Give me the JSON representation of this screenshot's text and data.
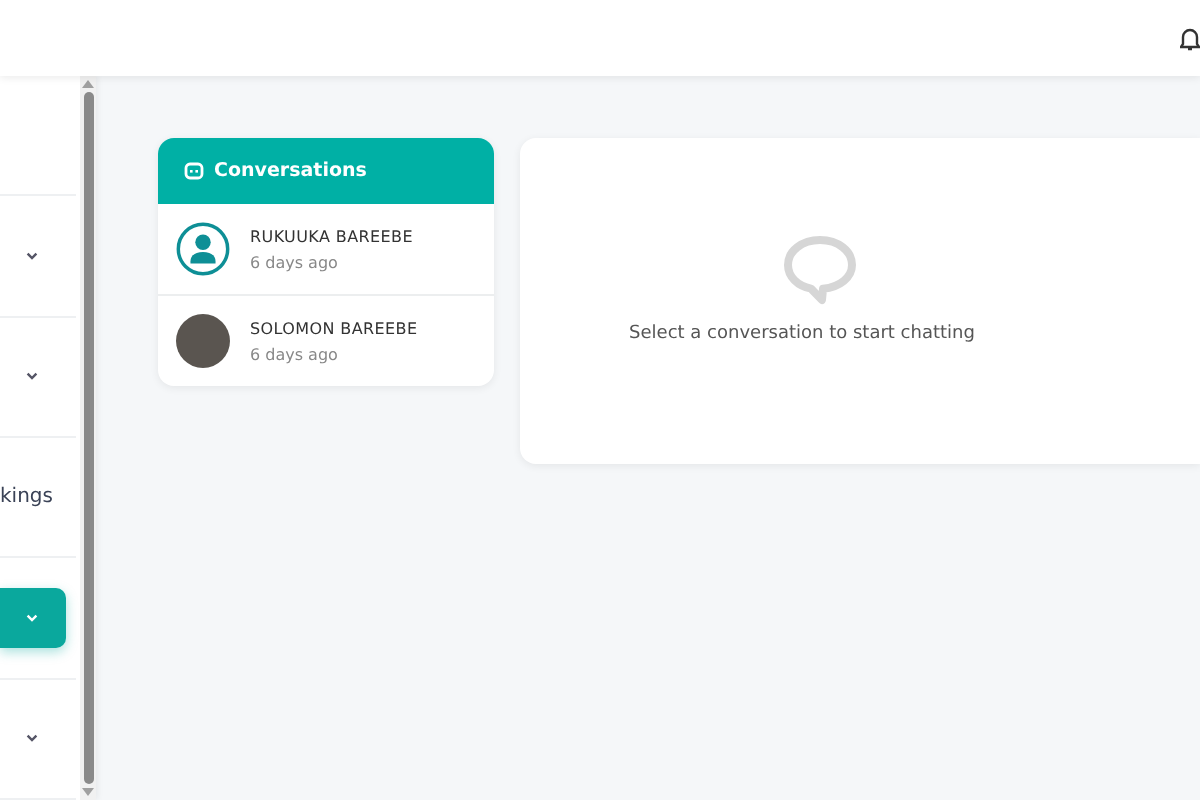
{
  "sidebar": {
    "items": [
      {
        "has_submenu": false,
        "selected": false
      },
      {
        "has_submenu": true,
        "selected": false
      },
      {
        "has_submenu": true,
        "selected": false
      },
      {
        "label": "kings",
        "has_submenu": false,
        "selected": false
      },
      {
        "has_submenu": true,
        "selected": true
      },
      {
        "has_submenu": true,
        "selected": false
      }
    ]
  },
  "conversations": {
    "title": "Conversations",
    "items": [
      {
        "name": "RUKUUKA BAREEBE",
        "time": "6 days ago",
        "kind": "default-avatar"
      },
      {
        "name": "SOLOMON BAREEBE",
        "time": "6 days ago",
        "kind": "photo-avatar"
      }
    ]
  },
  "chat": {
    "empty_message": "Select a conversation to start chatting"
  }
}
